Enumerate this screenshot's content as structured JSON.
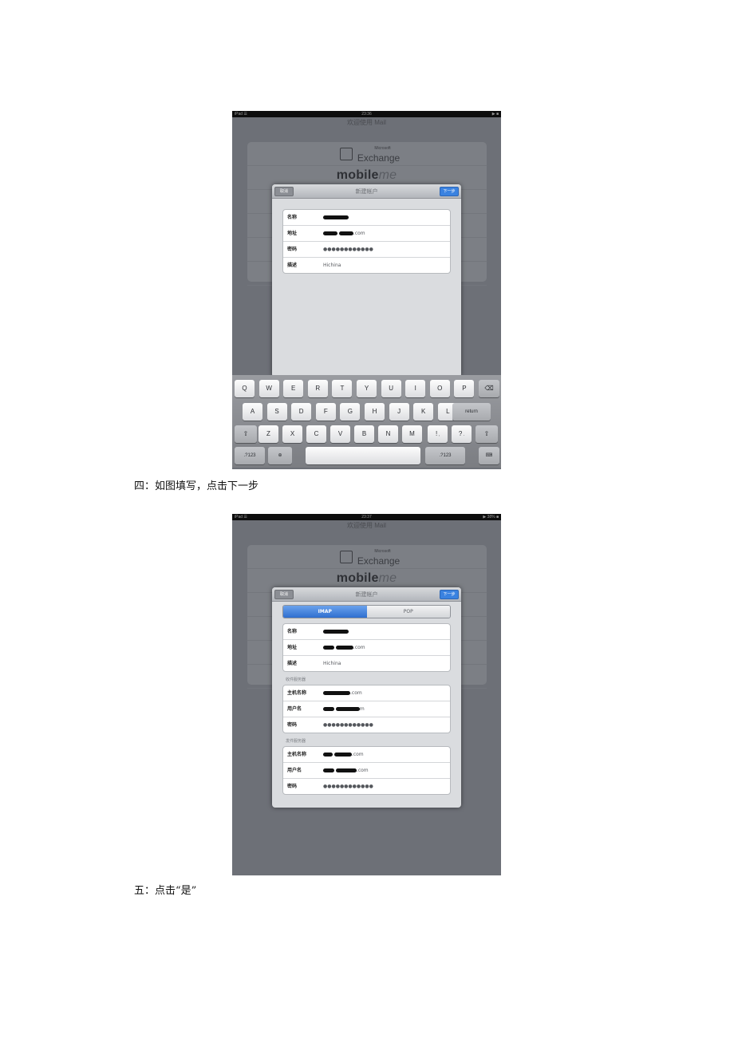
{
  "screenshot1": {
    "status": {
      "left": "iPad ☰",
      "time": "23:36",
      "right": "▶ ■"
    },
    "header_title": "欢迎使用 Mail",
    "providers": {
      "microsoft": "Microsoft",
      "exchange": "Exchange",
      "mobileme": "mobile",
      "mobileme_suffix": "me"
    },
    "sheet": {
      "title": "新建帐户",
      "cancel": "取消",
      "next": "下一步",
      "fields": [
        {
          "label": "名称",
          "value": ""
        },
        {
          "label": "地址",
          "value": ".com"
        },
        {
          "label": "密码",
          "value": "●●●●●●●●●●●●"
        },
        {
          "label": "描述",
          "value": "Hichina"
        }
      ]
    },
    "keyboard": {
      "row1": [
        "Q",
        "W",
        "E",
        "R",
        "T",
        "Y",
        "U",
        "I",
        "O",
        "P",
        "⌫"
      ],
      "row2": [
        "A",
        "S",
        "D",
        "F",
        "G",
        "H",
        "J",
        "K",
        "L",
        "return"
      ],
      "row3": [
        "⇧",
        "Z",
        "X",
        "C",
        "V",
        "B",
        "N",
        "M",
        "!",
        ",",
        "?",
        ".",
        "⇧"
      ],
      "row4": [
        ".?123",
        "⊕",
        "",
        ".?123",
        "⌨"
      ]
    }
  },
  "caption1": "四：如图填写，点击下一步",
  "screenshot2": {
    "status": {
      "left": "iPad ☰",
      "time": "23:37",
      "right": "▶ 38% ■"
    },
    "header_title": "欢迎使用 Mail",
    "providers": {
      "microsoft": "Microsoft",
      "exchange": "Exchange",
      "mobileme": "mobile",
      "mobileme_suffix": "me"
    },
    "sheet": {
      "title": "新建帐户",
      "cancel": "取消",
      "next": "下一步",
      "segments": [
        "IMAP",
        "POP"
      ],
      "account_fields": [
        {
          "label": "名称",
          "value": ""
        },
        {
          "label": "地址",
          "value": ".com"
        },
        {
          "label": "描述",
          "value": "Hichina"
        }
      ],
      "incoming_header": "收件服务器",
      "incoming_fields": [
        {
          "label": "主机名称",
          "value": ".com"
        },
        {
          "label": "用户名",
          "value": "m"
        },
        {
          "label": "密码",
          "value": "●●●●●●●●●●●●"
        }
      ],
      "outgoing_header": "发件服务器",
      "outgoing_fields": [
        {
          "label": "主机名称",
          "value": ".com"
        },
        {
          "label": "用户名",
          "value": ".com"
        },
        {
          "label": "密码",
          "value": "●●●●●●●●●●●●"
        }
      ]
    }
  },
  "caption2": "五：点击“是”"
}
